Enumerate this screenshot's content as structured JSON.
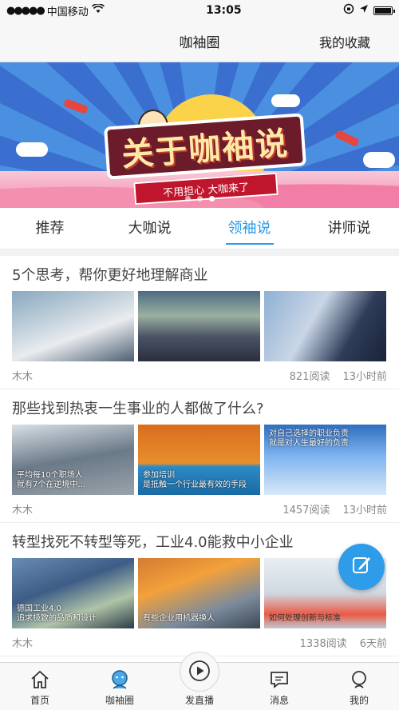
{
  "status_bar": {
    "carrier": "中国移动",
    "time": "13:05"
  },
  "navbar": {
    "title": "咖袖圈",
    "right_action": "我的收藏"
  },
  "banner": {
    "title": "关于咖袖说",
    "subtitle": "不用担心  大咖来了",
    "slide_count": 3,
    "active_slide": 2
  },
  "tabs": [
    {
      "label": "推荐",
      "active": false
    },
    {
      "label": "大咖说",
      "active": false
    },
    {
      "label": "领袖说",
      "active": true
    },
    {
      "label": "讲师说",
      "active": false
    }
  ],
  "articles": [
    {
      "title": "5个思考，帮你更好地理解商业",
      "author": "木木",
      "reads": "821阅读",
      "time": "13小时前",
      "thumb_captions": [
        "",
        "",
        ""
      ]
    },
    {
      "title": "那些找到热衷一生事业的人都做了什么?",
      "author": "木木",
      "reads": "1457阅读",
      "time": "13小时前",
      "thumb_captions": [
        "平均每10个职场人\n就有7个在逆境中...",
        "参加培训\n是抵触一个行业最有效的手段",
        "对自己选择的职业负责\n就是对人生最好的负责"
      ]
    },
    {
      "title": "转型找死不转型等死，工业4.0能救中小企业",
      "author": "木木",
      "reads": "1338阅读",
      "time": "6天前",
      "thumb_captions": [
        "德国工业4.0\n追求极致的品质和设计",
        "有些企业用机器换人",
        "如何处理创新与标准"
      ]
    }
  ],
  "fab": {
    "icon": "edit-icon"
  },
  "tabbar": [
    {
      "label": "首页",
      "icon": "home-icon"
    },
    {
      "label": "咖袖圈",
      "icon": "circle-icon"
    },
    {
      "label": "发直播",
      "icon": "play-icon"
    },
    {
      "label": "消息",
      "icon": "message-icon"
    },
    {
      "label": "我的",
      "icon": "user-icon"
    }
  ],
  "colors": {
    "accent": "#2b9ae8",
    "fab": "#2e9ce8"
  }
}
